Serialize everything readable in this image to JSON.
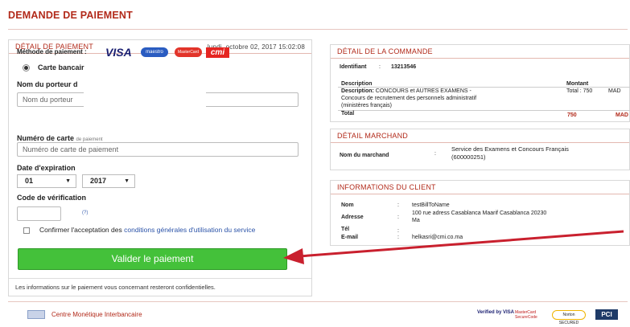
{
  "page_title": "DEMANDE DE PAIEMENT",
  "payment": {
    "panel_title": "DÉTAIL DE PAIEMENT",
    "datetime": "lundi, octobre 02, 2017 15:02:08",
    "method_label": "Méthode de paiement :",
    "card_logos": [
      "VISA",
      "maestro",
      "MasterCard",
      "cmi"
    ],
    "card_type_label": "Carte bancair",
    "holder_label": "Nom du porteur d",
    "holder_placeholder": "Nom du porteur",
    "card_number_label": "Numéro de carte",
    "card_number_label_tail": "de paiement",
    "card_number_placeholder": "Numéro de carte de paiement",
    "expiry_label": "Date d'expiration",
    "expiry_month": "01",
    "expiry_year": "2017",
    "cvv_label": "Code de vérification",
    "cvv_help": "(?)",
    "terms_prefix": "Confirmer l'acceptation des",
    "terms_link": "conditions générales d'utilisation du service",
    "submit_label": "Valider le paiement",
    "privacy_note": "Les informations sur le paiement vous concernant resteront confidentielles."
  },
  "order": {
    "panel_title": "DÉTAIL DE LA COMMANDE",
    "id_label": "Identifiant",
    "id_value": "13213546",
    "col_description": "Description",
    "col_amount": "Montant",
    "row_label": "Description:",
    "row_text_1": "CONCOURS et AUTRES EXAMENS -",
    "row_text_2": "Concours de recrutement des personnels administratif",
    "row_text_3": "(ministères français)",
    "row_amount": "Total : 750",
    "row_currency": "MAD",
    "total_label": "Total",
    "total_value": "750",
    "total_currency": "MAD"
  },
  "merchant": {
    "panel_title": "DÉTAIL MARCHAND",
    "name_label": "Nom du marchand",
    "name_value_1": "Service des Examens et Concours Français",
    "name_value_2": "(600000251)"
  },
  "client": {
    "panel_title": "INFORMATIONS DU CLIENT",
    "name_label": "Nom",
    "name_value": "testBillToName",
    "address_label": "Adresse",
    "address_value_1": "100 rue adress Casablanca Maarif Casablanca 20230",
    "address_value_2": "Ma",
    "phone_label": "Tél",
    "email_label": "E-mail",
    "email_value": "helkasri@cmi.co.ma"
  },
  "footer": {
    "org_name": "Centre Monétique Interbancaire",
    "badges": [
      "Verified by VISA",
      "MasterCard SecureCode",
      "Norton SECURED",
      "PCI"
    ]
  },
  "colors": {
    "accent": "#b22a1a",
    "button": "#44c13a",
    "arrow": "#c9202e"
  }
}
